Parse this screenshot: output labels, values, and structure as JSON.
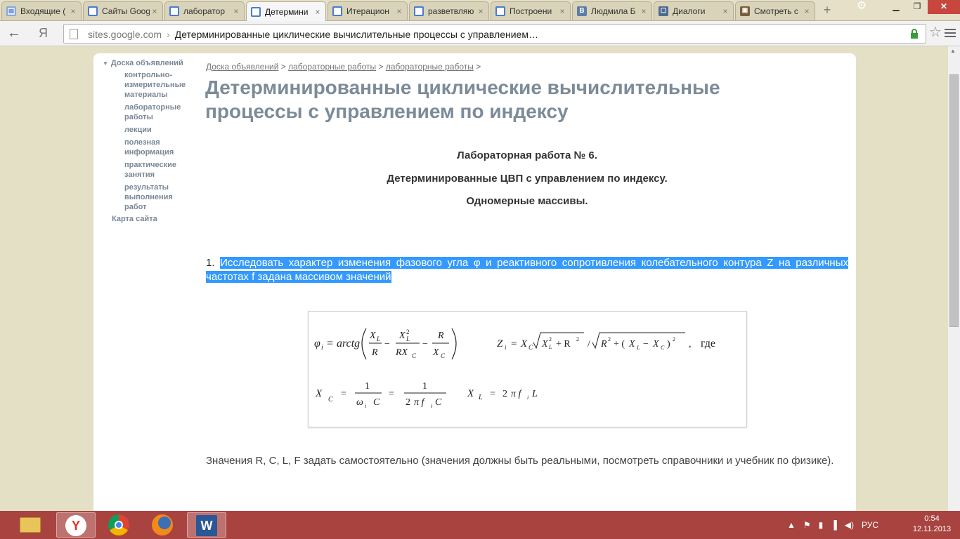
{
  "tabs": [
    {
      "label": "Входящие (",
      "icon": "mail-icon"
    },
    {
      "label": "Сайты Goog",
      "icon": "sites-icon"
    },
    {
      "label": "лаборатор",
      "icon": "sites-icon"
    },
    {
      "label": "Детермини",
      "icon": "sites-icon",
      "active": true
    },
    {
      "label": "Итерацион",
      "icon": "sites-icon"
    },
    {
      "label": "разветвляю",
      "icon": "sites-icon"
    },
    {
      "label": "Построени",
      "icon": "sites-icon"
    },
    {
      "label": "Людмила Б",
      "icon": "vk-icon"
    },
    {
      "label": "Диалоги",
      "icon": "dialog-icon"
    },
    {
      "label": "Смотреть с",
      "icon": "tv-icon"
    }
  ],
  "toolbar": {
    "yandex": "Я",
    "host": "sites.google.com",
    "separator": "›",
    "page_title": "Детерминированные циклические вычислительные процессы с управлением…"
  },
  "sidebar": {
    "header": "Доска объявлений",
    "items": [
      "контрольно-измерительные материалы",
      "лабораторные работы",
      "лекции",
      "полезная информация",
      "практические занятия",
      "результаты выполнения работ"
    ],
    "sitemap": "Карта сайта"
  },
  "breadcrumb": {
    "items": [
      "Доска объявлений",
      "лабораторные работы",
      "лабораторные работы"
    ],
    "sep": ">"
  },
  "main": {
    "title": "Детерминированные циклические вычислительные процессы с управлением по индексу",
    "lab_title": "Лабораторная работа № 6.",
    "lab_subtitle": "Детерминированные ЦВП с управлением по индексу.",
    "lab_topic": "Одномерные массивы.",
    "task_num": "1. ",
    "task_text": "Исследовать характер изменения фазового угла  φ и реактивного сопротивления колебательного контура Z на различных частотах  f задана массивом значений",
    "values_text": "Значения R, C, L, F задать самостоятельно (значения должны быть реальными, посмотреть справочники и учебник по физике)."
  },
  "formula": {
    "where_word": "где"
  },
  "taskbar": {
    "apps": [
      "explorer",
      "yandex-browser",
      "chrome",
      "firefox",
      "word"
    ]
  },
  "tray": {
    "lang": "РУС",
    "time": "0:54",
    "date": "12.11.2013"
  }
}
